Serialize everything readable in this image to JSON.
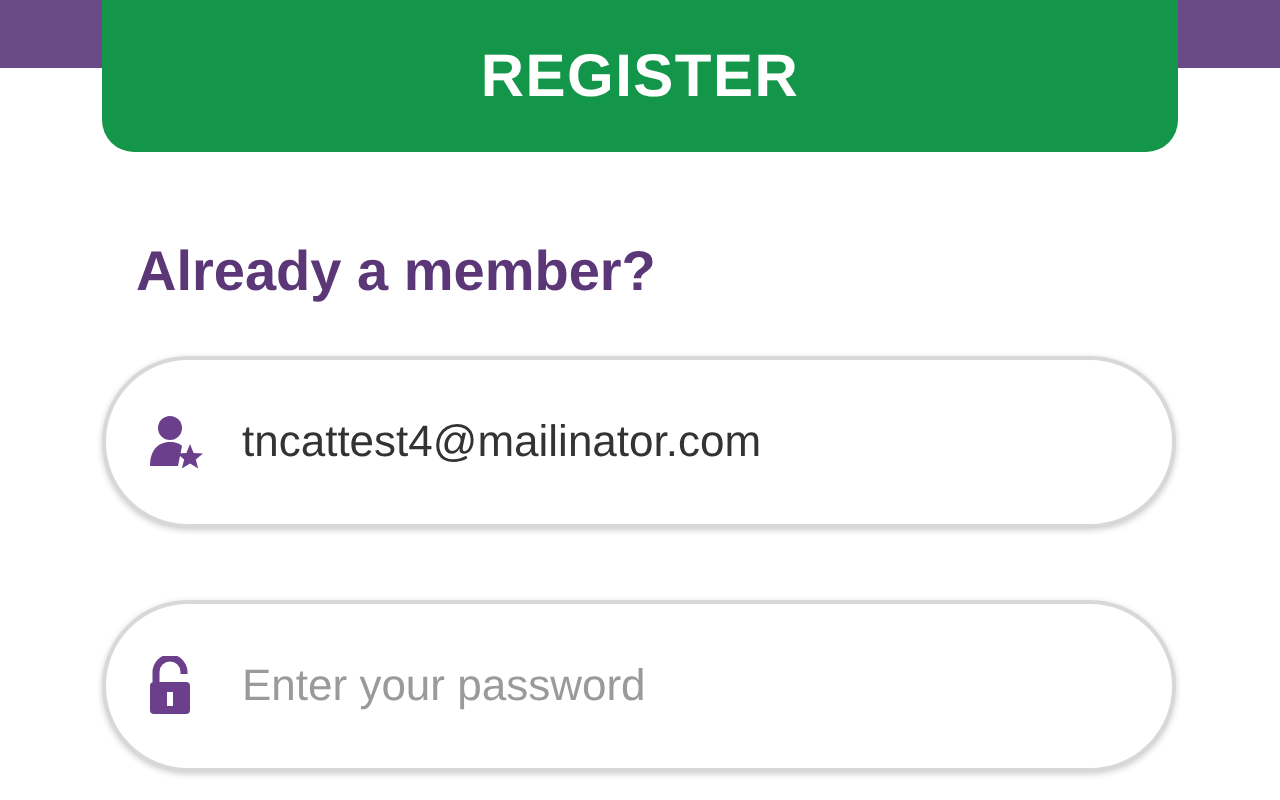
{
  "register_button": {
    "label": "REGISTER"
  },
  "login": {
    "heading": "Already a member?",
    "fields": [
      {
        "kind": "email",
        "value": "tncattest4@mailinator.com"
      },
      {
        "kind": "password",
        "placeholder": "Enter your password"
      }
    ]
  }
}
